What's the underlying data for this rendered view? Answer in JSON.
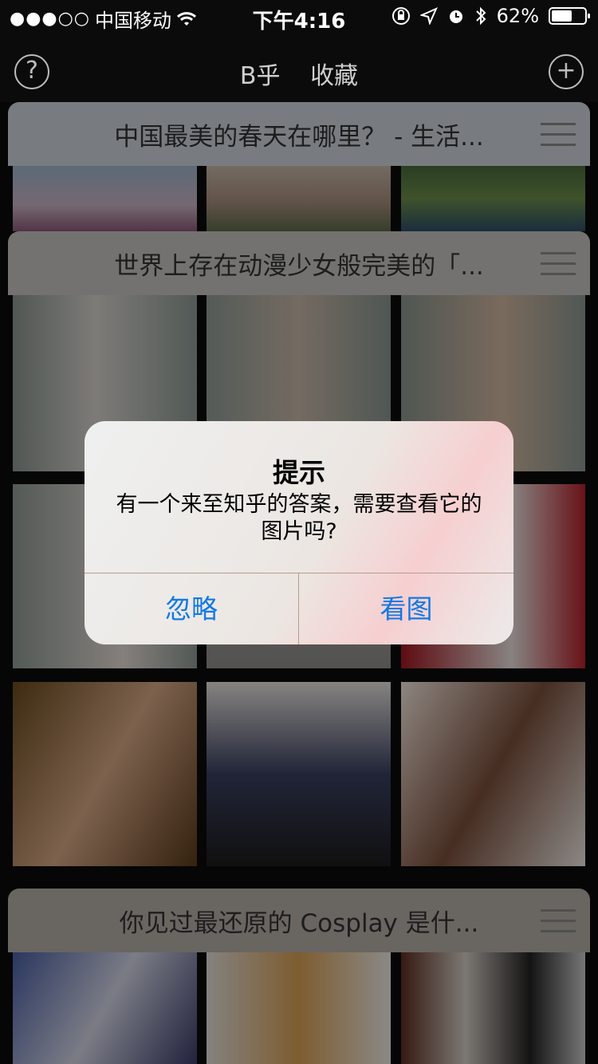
{
  "status_bar": {
    "signal": "●●●○○",
    "carrier": "中国移动",
    "time": "下午4:16",
    "battery": "62%",
    "battery_level": 0.62
  },
  "nav": {
    "title_left": "B乎",
    "title_right": "收藏",
    "help_icon": "?",
    "add_icon": "+"
  },
  "cards": [
    {
      "title": "中国最美的春天在哪里？ - 生活..."
    },
    {
      "title": "世界上存在动漫少女般完美的「..."
    },
    {
      "title": "你见过最还原的 Cosplay 是什..."
    }
  ],
  "alert": {
    "title": "提示",
    "message": "有一个来至知乎的答案，需要查看它的图片吗?",
    "ignore_label": "忽略",
    "view_label": "看图"
  },
  "colors": {
    "accent": "#1179e6",
    "background": "#0b0b0b"
  }
}
